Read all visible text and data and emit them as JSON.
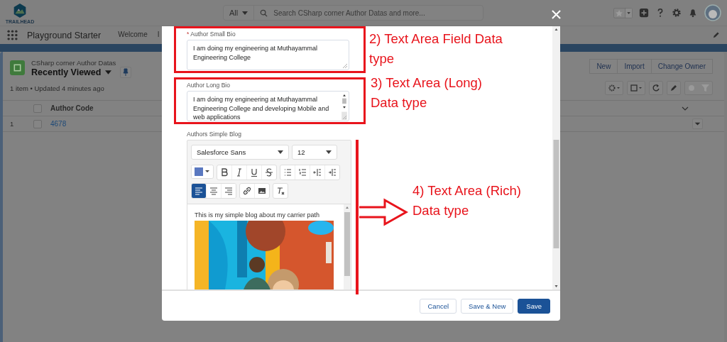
{
  "header": {
    "logo_text": "TRAILHEAD",
    "search_scope": "All",
    "search_placeholder": "Search CSharp corner Author Datas and more..."
  },
  "nav": {
    "app_name": "Playground Starter",
    "tabs": [
      {
        "label": "Welcome",
        "selected": false
      },
      {
        "label": "I",
        "selected": false
      }
    ]
  },
  "list_view": {
    "object": "CSharp corner Author Datas",
    "view": "Recently Viewed",
    "status": "1 item • Updated 4 minutes ago",
    "actions": [
      "New",
      "Import",
      "Change Owner"
    ],
    "columns": [
      "Author Code"
    ],
    "select_all_checked": false,
    "rows": [
      {
        "number": "1",
        "author_code": "4678",
        "checked": false
      }
    ]
  },
  "modal": {
    "fields": [
      {
        "kind": "textarea",
        "label": "Author Small Bio",
        "required_mark": "*",
        "annotated": true,
        "value": "I am doing my engineering at Muthayammal Engineering College"
      },
      {
        "kind": "long_textarea",
        "label": "Author Long Bio",
        "annotated": true,
        "value": "I am doing my engineering at Muthayammal Engineering College and developing Mobile and web applications"
      },
      {
        "kind": "rich_text",
        "label": "Authors Simple Blog",
        "annotated": false,
        "font": "Salesforce Sans",
        "size": "12",
        "text": "This is my simple blog about my carrier path",
        "alignment": [
          {
            "selected": true
          },
          {
            "selected": false
          },
          {
            "selected": false
          }
        ]
      }
    ],
    "buttons": [
      {
        "label": "Cancel",
        "kind": "neutral"
      },
      {
        "label": "Save & New",
        "kind": "neutral"
      },
      {
        "label": "Save",
        "kind": "brand"
      }
    ]
  },
  "annotations": [
    {
      "lines": [
        "2) Text Area Field Data",
        "type"
      ]
    },
    {
      "lines": [
        "3) Text Area (Long)",
        "Data type"
      ]
    },
    {
      "lines": [
        "4) Text Area (Rich)",
        "Data type"
      ]
    }
  ]
}
